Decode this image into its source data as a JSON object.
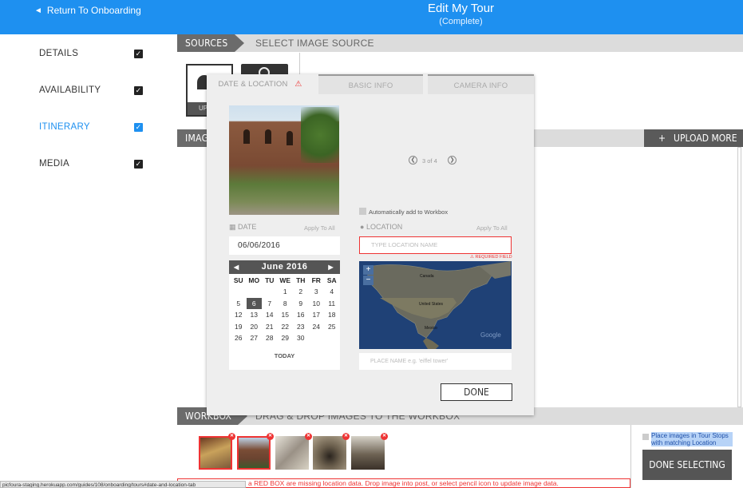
{
  "header": {
    "back_label": "Return To Onboarding",
    "title": "Edit My Tour",
    "subtitle": "(Complete)"
  },
  "sidebar": {
    "items": [
      {
        "label": "DETAILS",
        "checked": true,
        "active": false
      },
      {
        "label": "AVAILABILITY",
        "checked": true,
        "active": false
      },
      {
        "label": "ITINERARY",
        "checked": true,
        "active": true
      },
      {
        "label": "MEDIA",
        "checked": true,
        "active": false
      }
    ]
  },
  "sources": {
    "label": "SOURCES",
    "text": "SELECT IMAGE SOURCE",
    "upload_tile_label": "UP"
  },
  "images_bar": {
    "label": "IMAGE",
    "upload_more": "UPLOAD MORE"
  },
  "modal": {
    "tabs": [
      {
        "label": "DATE & LOCATION",
        "active": true,
        "warning": true
      },
      {
        "label": "BASIC INFO",
        "active": false
      },
      {
        "label": "CAMERA INFO",
        "active": false
      }
    ],
    "pager": "3 of 4",
    "auto_add_label": "Automatically add to Workbox",
    "date_label": "DATE",
    "date_apply_all": "Apply To All",
    "date_value": "06/06/2016",
    "location_label": "LOCATION",
    "location_apply_all": "Apply To All",
    "location_placeholder": "TYPE LOCATION NAME",
    "required_field": "REQUIRED FIELD",
    "place_placeholder": "PLACE NAME e.g. 'eiffel tower'",
    "done_label": "DONE",
    "calendar": {
      "month": "June 2016",
      "weekdays": [
        "SU",
        "MO",
        "TU",
        "WE",
        "TH",
        "FR",
        "SA"
      ],
      "weeks": [
        [
          "",
          "",
          "",
          "1",
          "2",
          "3",
          "4"
        ],
        [
          "5",
          "6",
          "7",
          "8",
          "9",
          "10",
          "11"
        ],
        [
          "12",
          "13",
          "14",
          "15",
          "16",
          "17",
          "18"
        ],
        [
          "19",
          "20",
          "21",
          "22",
          "23",
          "24",
          "25"
        ],
        [
          "26",
          "27",
          "28",
          "29",
          "30",
          "",
          ""
        ]
      ],
      "selected": "6",
      "today_label": "TODAY"
    },
    "map": {
      "labels": [
        "Canada",
        "United States",
        "Mexico"
      ],
      "zoom_in": "+",
      "zoom_out": "−",
      "watermark": "Google"
    }
  },
  "workbox": {
    "label": "WORKBOX",
    "text": "DRAG & DROP IMAGES TO THE WORKBOX",
    "thumb_count": 5,
    "notice": "a RED BOX are missing location data. Drop image into post, or select pencil icon to update image data.",
    "place_images_label": "Place images in Tour Stops with matching Location",
    "done_selecting": "DONE SELECTING"
  },
  "status_url": "picfoura-staging.herokuapp.com/guides/108/onboarding/tours#date-and-location-tab",
  "colors": {
    "brand_blue": "#1e90f0",
    "bar_dark": "#6b6b6b",
    "warning_red": "#e33333"
  }
}
